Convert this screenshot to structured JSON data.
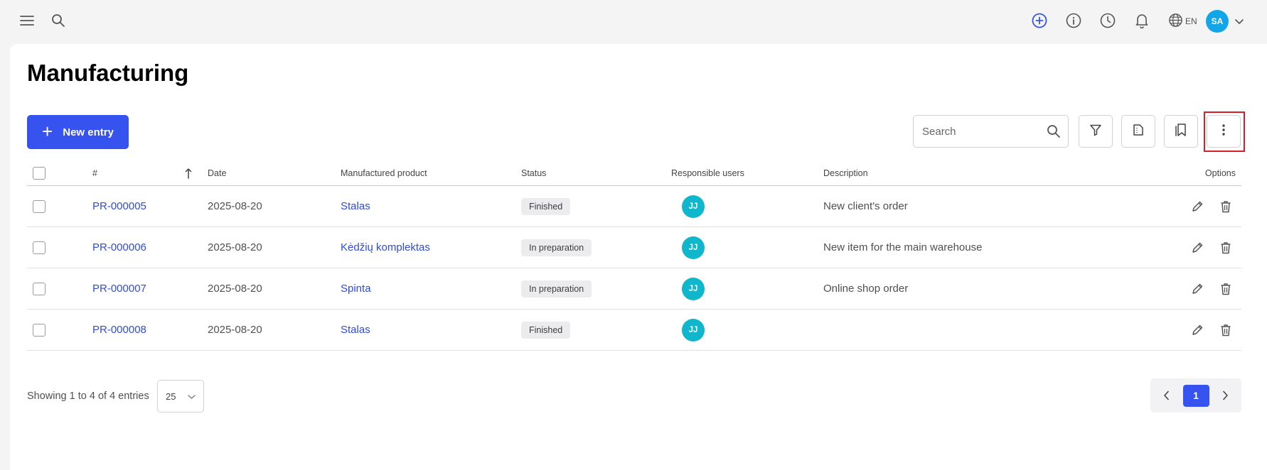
{
  "header": {
    "language": "EN",
    "user_initials": "SA",
    "icons": [
      "menu-icon",
      "search-icon",
      "add-circle-icon",
      "info-icon",
      "clock-icon",
      "bell-icon",
      "globe-icon",
      "chevron-down-icon"
    ],
    "accent_color": "#3653f0"
  },
  "page": {
    "title": "Manufacturing"
  },
  "toolbar": {
    "new_entry_label": "New entry",
    "search_placeholder": "Search",
    "search_value": ""
  },
  "table": {
    "columns": {
      "number": "#",
      "date": "Date",
      "product": "Manufactured product",
      "status": "Status",
      "users": "Responsible users",
      "description": "Description",
      "options": "Options"
    },
    "rows": [
      {
        "id": "PR-000005",
        "date": "2025-08-20",
        "product": "Stalas",
        "status": "Finished",
        "user": "JJ",
        "description": "New client's order"
      },
      {
        "id": "PR-000006",
        "date": "2025-08-20",
        "product": "Kėdžių komplektas",
        "status": "In preparation",
        "user": "JJ",
        "description": "New item for the main warehouse"
      },
      {
        "id": "PR-000007",
        "date": "2025-08-20",
        "product": "Spinta",
        "status": "In preparation",
        "user": "JJ",
        "description": "Online shop order"
      },
      {
        "id": "PR-000008",
        "date": "2025-08-20",
        "product": "Stalas",
        "status": "Finished",
        "user": "JJ",
        "description": ""
      }
    ]
  },
  "footer": {
    "showing_text": "Showing 1 to 4 of 4 entries",
    "page_size": "25",
    "current_page": "1"
  }
}
